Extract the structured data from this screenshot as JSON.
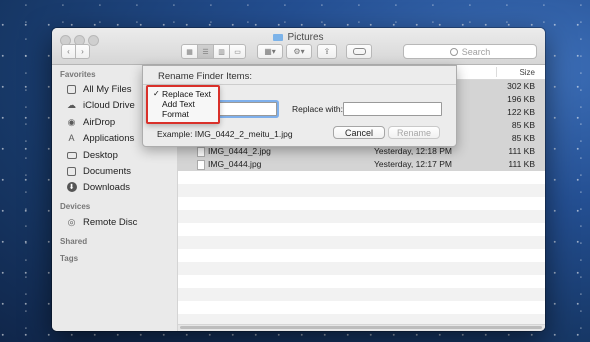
{
  "window": {
    "title": "Pictures"
  },
  "toolbar": {
    "back_glyph": "‹",
    "forward_glyph": "›",
    "view_glyphs": [
      "▦",
      "☰",
      "▥",
      "▭"
    ],
    "arrange_glyph": "▦▾",
    "action_glyph": "⚙▾",
    "share_glyph": "⇪",
    "search_placeholder": "Search"
  },
  "sidebar": {
    "favorites_header": "Favorites",
    "favorites": [
      {
        "label": "All My Files",
        "icon": "all-files-icon",
        "glyph": "▤"
      },
      {
        "label": "iCloud Drive",
        "icon": "cloud-icon",
        "glyph": "☁"
      },
      {
        "label": "AirDrop",
        "icon": "airdrop-icon",
        "glyph": "◉"
      },
      {
        "label": "Applications",
        "icon": "applications-icon",
        "glyph": "A"
      },
      {
        "label": "Desktop",
        "icon": "desktop-icon",
        "glyph": "▬"
      },
      {
        "label": "Documents",
        "icon": "documents-icon",
        "glyph": "▤"
      },
      {
        "label": "Downloads",
        "icon": "downloads-icon",
        "glyph": "⬇"
      }
    ],
    "devices_header": "Devices",
    "devices": [
      {
        "label": "Remote Disc",
        "icon": "disc-icon",
        "glyph": "◎"
      }
    ],
    "shared_header": "Shared",
    "tags_header": "Tags"
  },
  "file_list": {
    "size_header": "Size",
    "rows": [
      {
        "name": "",
        "date": "",
        "size": "302 KB"
      },
      {
        "name": "",
        "date": "",
        "size": "196 KB"
      },
      {
        "name": "",
        "date": "",
        "size": "122 KB"
      },
      {
        "name": "",
        "date": "",
        "size": "85 KB"
      },
      {
        "name": "",
        "date": "",
        "size": "85 KB"
      },
      {
        "name": "IMG_0444_2.jpg",
        "date": "Yesterday, 12:18 PM",
        "size": "111 KB"
      },
      {
        "name": "IMG_0444.jpg",
        "date": "Yesterday, 12:17 PM",
        "size": "111 KB"
      }
    ]
  },
  "rename_dialog": {
    "title": "Rename Finder Items:",
    "mode_options": [
      "Replace Text",
      "Add Text",
      "Format"
    ],
    "selected_mode": "Replace Text",
    "check_mark": "✓",
    "find_value": "",
    "replace_label": "Replace with:",
    "replace_value": "",
    "example": "Example: IMG_0442_2_meitu_1.jpg",
    "cancel_label": "Cancel",
    "rename_label": "Rename"
  }
}
